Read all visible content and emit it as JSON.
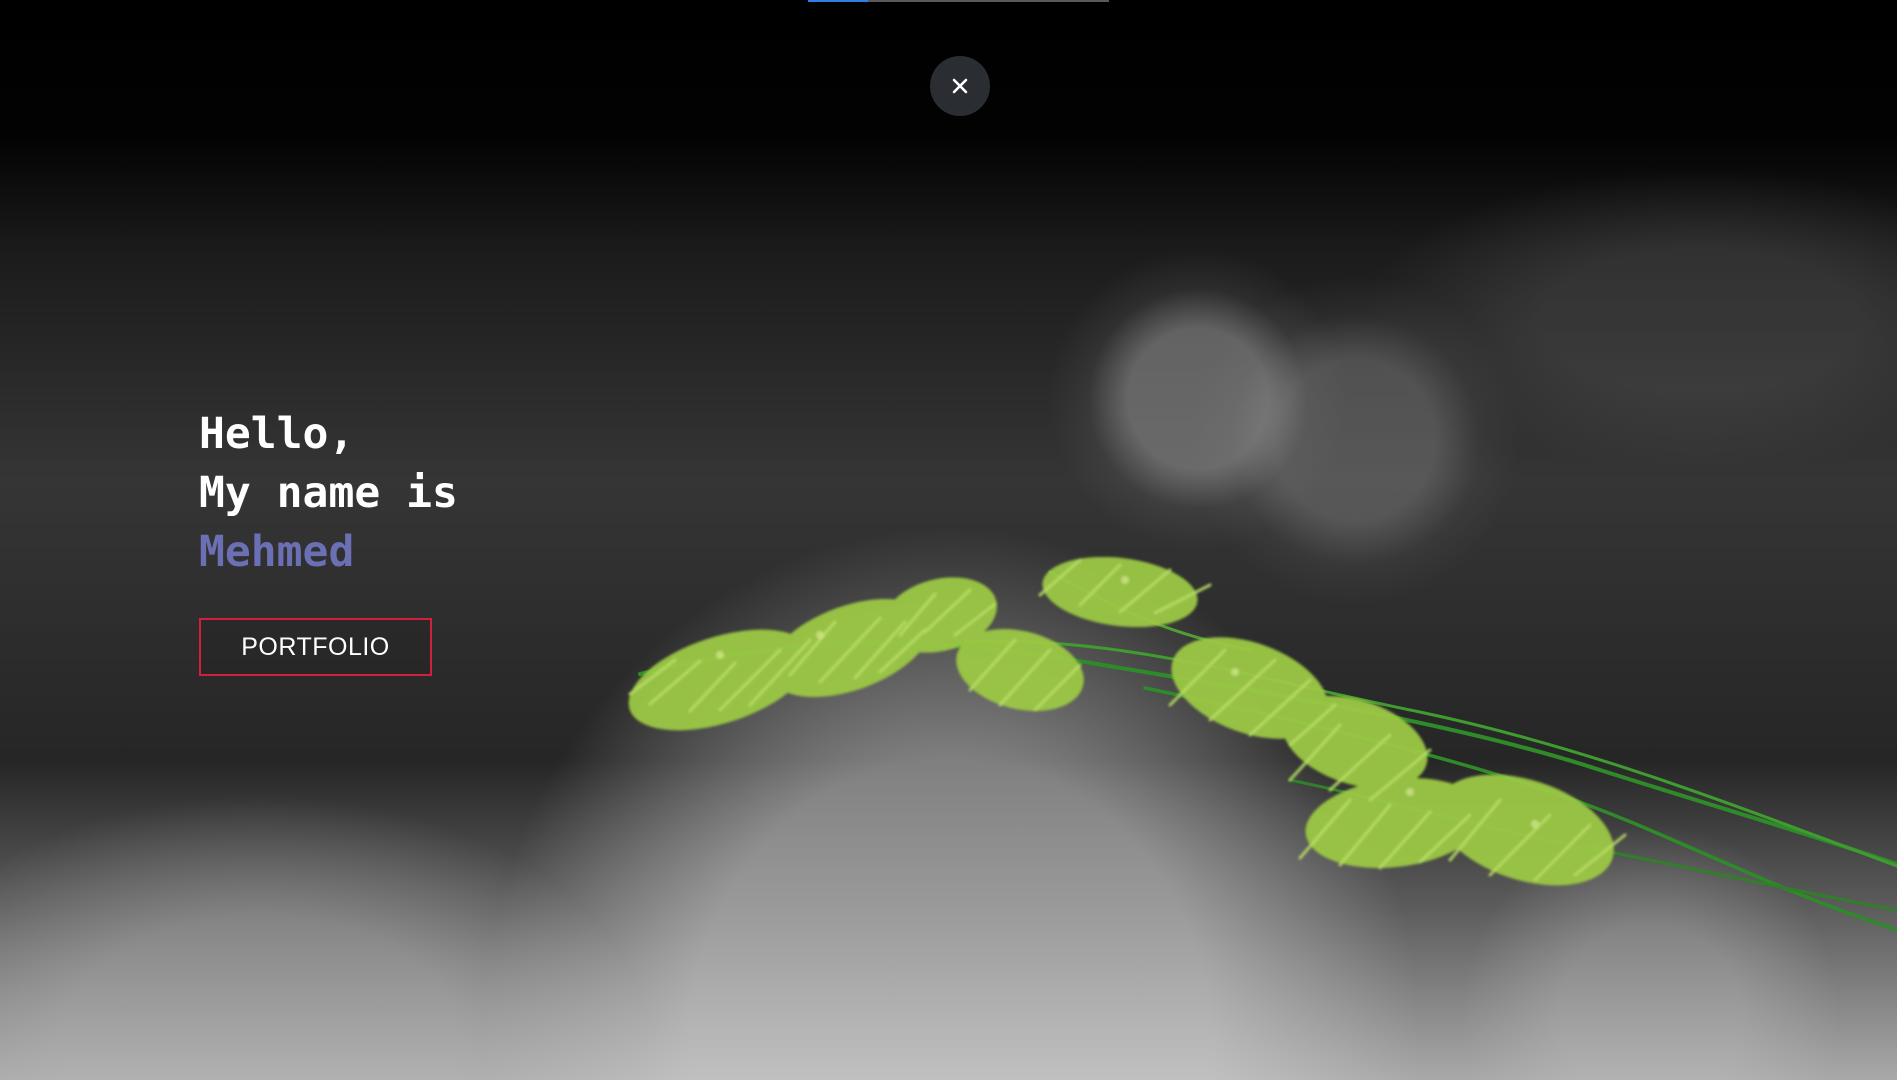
{
  "hero": {
    "greeting": "Hello,",
    "intro": "My name is",
    "name": "Mehmed",
    "button_label": "PORTFOLIO"
  },
  "controls": {
    "close_icon": "close-icon"
  },
  "progress": {
    "value": 0.2
  },
  "colors": {
    "background": "#000000",
    "hero_text": "#ffffff",
    "name_accent": "#6b6fb4",
    "button_border": "#d11f3d",
    "close_button_bg": "#2a2d31",
    "progress_fill": "#2f7ee8",
    "grass_green": "#8bbd39"
  }
}
